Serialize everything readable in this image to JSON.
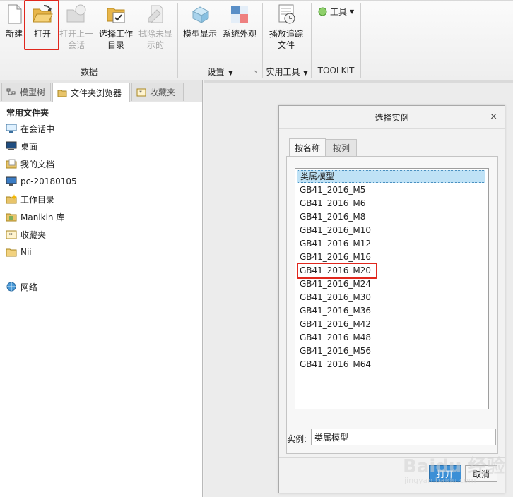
{
  "ribbon": {
    "buttons": [
      {
        "label": "新建",
        "disabled": false,
        "icon": "new-file-icon"
      },
      {
        "label": "打开",
        "disabled": false,
        "icon": "open-folder-icon"
      },
      {
        "label": "打开上一\n会话",
        "disabled": true,
        "icon": "open-last-session-icon"
      },
      {
        "label": "选择工作\n目录",
        "disabled": false,
        "icon": "select-working-directory-icon"
      },
      {
        "label": "拭除未显\n示的",
        "disabled": true,
        "icon": "erase-not-displayed-icon"
      },
      {
        "label": "模型显示",
        "disabled": false,
        "icon": "model-display-icon"
      },
      {
        "label": "系统外观",
        "disabled": false,
        "icon": "system-appearance-icon"
      },
      {
        "label": "播放追踪\n文件",
        "disabled": false,
        "icon": "play-trail-file-icon"
      }
    ],
    "tools_dropdown": "工具",
    "groups": {
      "data": "数据",
      "settings": "设置",
      "utilities": "实用工具",
      "toolkit": "TOOLKIT"
    }
  },
  "left_panel": {
    "tabs": [
      "模型树",
      "文件夹浏览器",
      "收藏夹"
    ],
    "active_tab": "文件夹浏览器",
    "section_title": "常用文件夹",
    "items": [
      {
        "label": "在会话中",
        "icon": "in-session-icon"
      },
      {
        "label": "桌面",
        "icon": "desktop-icon"
      },
      {
        "label": "我的文档",
        "icon": "my-documents-icon"
      },
      {
        "label": "pc-20180105",
        "icon": "computer-icon"
      },
      {
        "label": "工作目录",
        "icon": "working-directory-icon"
      },
      {
        "label": "Manikin 库",
        "icon": "library-icon"
      },
      {
        "label": "收藏夹",
        "icon": "favorites-icon"
      },
      {
        "label": "Nii",
        "icon": "folder-icon"
      },
      {
        "label": "网络",
        "icon": "network-icon"
      }
    ]
  },
  "dialog": {
    "title": "选择实例",
    "close_glyph": "×",
    "tabs": [
      "按名称",
      "按列"
    ],
    "active_tab": "按名称",
    "instances": [
      "类属模型",
      "GB41_2016_M5",
      "GB41_2016_M6",
      "GB41_2016_M8",
      "GB41_2016_M10",
      "GB41_2016_M12",
      "GB41_2016_M16",
      "GB41_2016_M20",
      "GB41_2016_M24",
      "GB41_2016_M30",
      "GB41_2016_M36",
      "GB41_2016_M42",
      "GB41_2016_M48",
      "GB41_2016_M56",
      "GB41_2016_M64"
    ],
    "selected_index": 0,
    "highlighted_index": 7,
    "instance_label": "实例:",
    "instance_value": "类属模型",
    "open_button": "打开",
    "cancel_button": "取消"
  },
  "colors": {
    "highlight_red": "#e0271d",
    "selection_blue": "#bfe2f6",
    "primary_button": "#3b8fd6"
  },
  "watermark": {
    "text": "Baidu 经验",
    "url": "jingyan.baidu.com"
  }
}
